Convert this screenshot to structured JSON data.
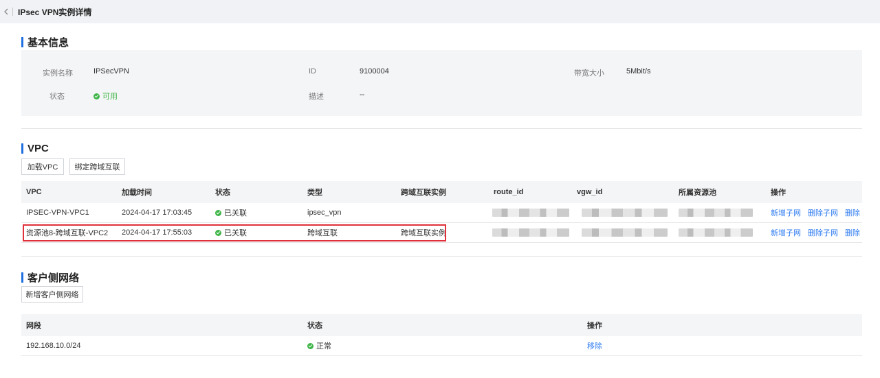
{
  "header": {
    "title": "IPsec VPN实例详情"
  },
  "basic": {
    "section_title": "基本信息",
    "name_label": "实例名称",
    "name_value": "IPSecVPN",
    "id_label": "ID",
    "id_value": "9100004",
    "bandwidth_label": "带宽大小",
    "bandwidth_value": "5Mbit/s",
    "status_label": "状态",
    "status_value": "可用",
    "desc_label": "描述",
    "desc_value": "--"
  },
  "vpc": {
    "section_title": "VPC",
    "buttons": {
      "load": "加载VPC",
      "bind": "绑定跨域互联"
    },
    "columns": [
      "VPC",
      "加载时间",
      "状态",
      "类型",
      "跨域互联实例",
      "route_id",
      "vgw_id",
      "所属资源池",
      "操作"
    ],
    "rows": [
      {
        "vpc": "IPSEC-VPN-VPC1",
        "time": "2024-04-17 17:03:45",
        "status": "已关联",
        "type": "ipsec_vpn",
        "instance": "",
        "route_id": "",
        "vgw_id": "",
        "pool": ""
      },
      {
        "vpc": "资源池8-跨域互联-VPC2",
        "time": "2024-04-17 17:55:03",
        "status": "已关联",
        "type": "跨域互联",
        "instance": "跨域互联实例",
        "route_id": "",
        "vgw_id": "",
        "pool": ""
      }
    ],
    "actions": {
      "add_subnet": "新增子网",
      "del_subnet": "删除子网",
      "delete": "删除"
    }
  },
  "client": {
    "section_title": "客户侧网络",
    "add_button": "新增客户侧网络",
    "columns": [
      "网段",
      "状态",
      "操作"
    ],
    "rows": [
      {
        "segment": "192.168.10.0/24",
        "status": "正常",
        "action": "移除"
      }
    ]
  },
  "colors": {
    "accent": "#1f6fe0",
    "success": "#3fb548",
    "link": "#2f7cf0",
    "highlight": "#e0303a"
  }
}
